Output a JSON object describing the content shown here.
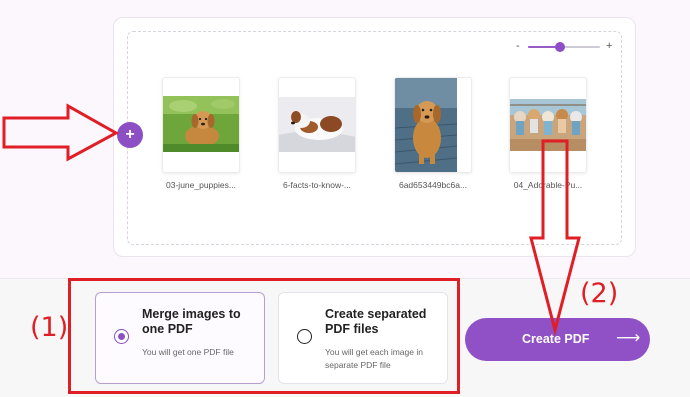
{
  "colors": {
    "accent": "#8d4fc4",
    "annotation_red": "#e01e25",
    "panel_background": "#fbf7fd"
  },
  "zoom": {
    "minus_label": "-",
    "plus_label": "+",
    "level": 0.45
  },
  "add_button": {
    "symbol": "+",
    "icon": "plus-icon"
  },
  "thumbnails": [
    {
      "filename": "03-june_puppies..."
    },
    {
      "filename": "6-facts-to-know-..."
    },
    {
      "filename": "6ad653449bc6a..."
    },
    {
      "filename": "04_Adorable-Pu..."
    }
  ],
  "options": [
    {
      "title": "Merge images to one PDF",
      "description": "You will get one PDF file",
      "selected": true
    },
    {
      "title": "Create separated PDF files",
      "description": "You will get each image in separate PDF file",
      "selected": false
    }
  ],
  "create_button": {
    "label": "Create PDF",
    "arrow": "⟶"
  },
  "annotations": {
    "label_1": "(1)",
    "label_2": "(2)"
  }
}
